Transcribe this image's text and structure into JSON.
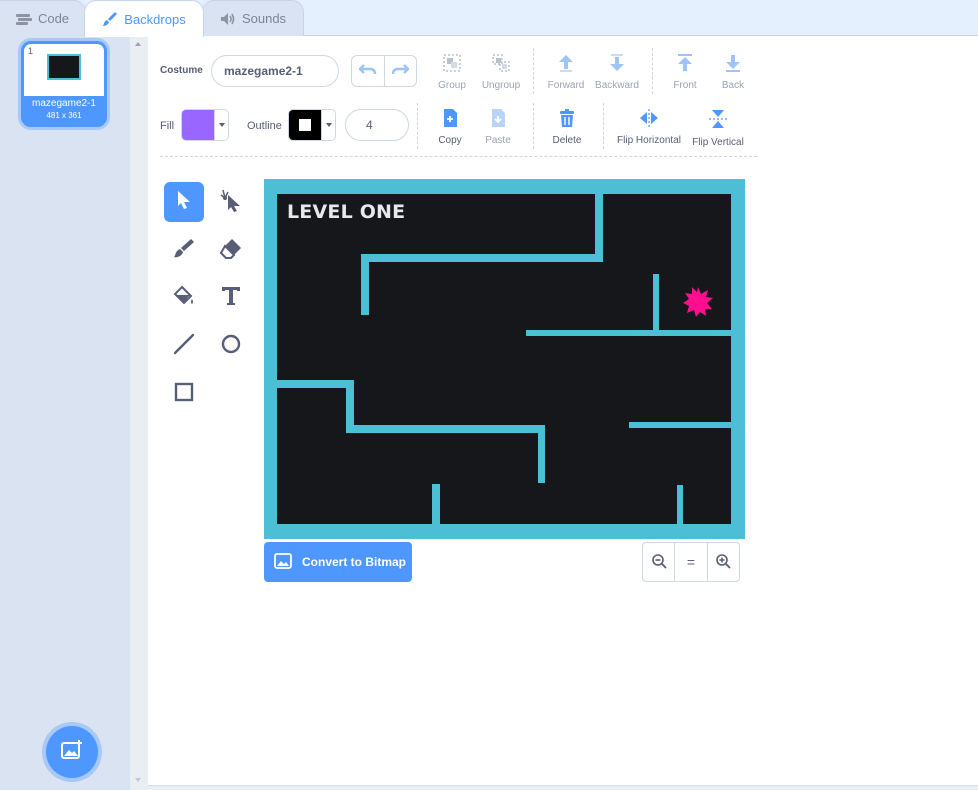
{
  "tabs": [
    {
      "label": "Code",
      "icon": "code-icon"
    },
    {
      "label": "Backdrops",
      "icon": "brush-icon"
    },
    {
      "label": "Sounds",
      "icon": "speaker-icon"
    }
  ],
  "backdrop_list": {
    "items": [
      {
        "number": "1",
        "name": "mazegame2-1",
        "size": "481 x 361"
      }
    ]
  },
  "toolbar": {
    "costume_label": "Costume",
    "costume_name": "mazegame2-1",
    "group_label": "Group",
    "ungroup_label": "Ungroup",
    "forward_label": "Forward",
    "backward_label": "Backward",
    "front_label": "Front",
    "back_label": "Back",
    "fill_label": "Fill",
    "outline_label": "Outline",
    "outline_width": "4",
    "copy_label": "Copy",
    "paste_label": "Paste",
    "delete_label": "Delete",
    "flip_horizontal_label": "Flip Horizontal",
    "flip_vertical_label": "Flip Vertical"
  },
  "colors": {
    "fill": "#9966ff",
    "outline": "#000000",
    "accent": "#4d97ff",
    "maze_wall": "#4cbfd6",
    "maze_background": "#16171a",
    "goal": "#ff0f8f"
  },
  "canvas": {
    "level_text": "LEVEL ONE"
  },
  "bottom": {
    "convert_label": "Convert to Bitmap",
    "zoom_reset": "="
  }
}
